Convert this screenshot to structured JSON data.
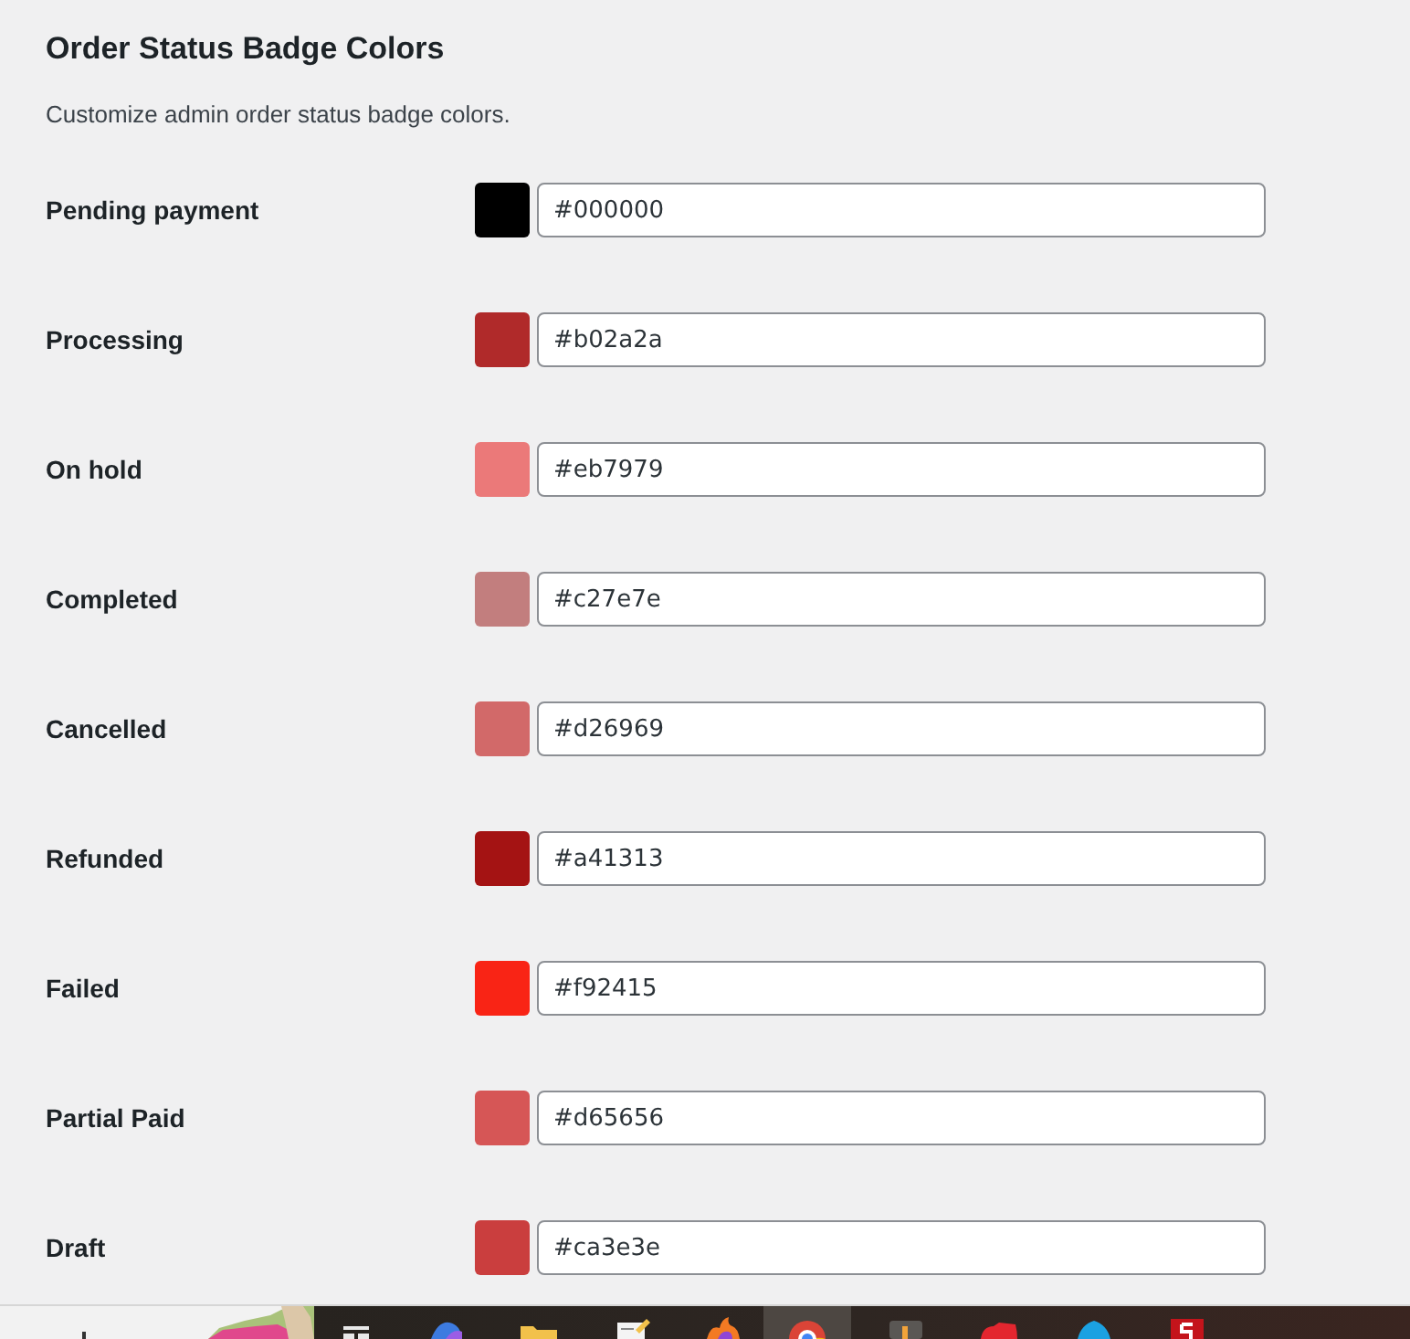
{
  "page": {
    "title": "Order Status Badge Colors",
    "description": "Customize admin order status badge colors."
  },
  "statuses": [
    {
      "label": "Pending payment",
      "value": "#000000",
      "color": "#000000"
    },
    {
      "label": "Processing",
      "value": "#b02a2a",
      "color": "#b02a2a"
    },
    {
      "label": "On hold",
      "value": "#eb7979",
      "color": "#eb7979"
    },
    {
      "label": "Completed",
      "value": "#c27e7e",
      "color": "#c27e7e"
    },
    {
      "label": "Cancelled",
      "value": "#d26969",
      "color": "#d26969"
    },
    {
      "label": "Refunded",
      "value": "#a41313",
      "color": "#a41313"
    },
    {
      "label": "Failed",
      "value": "#f92415",
      "color": "#f92415"
    },
    {
      "label": "Partial Paid",
      "value": "#d65656",
      "color": "#d65656"
    },
    {
      "label": "Draft",
      "value": "#ca3e3e",
      "color": "#ca3e3e"
    }
  ]
}
